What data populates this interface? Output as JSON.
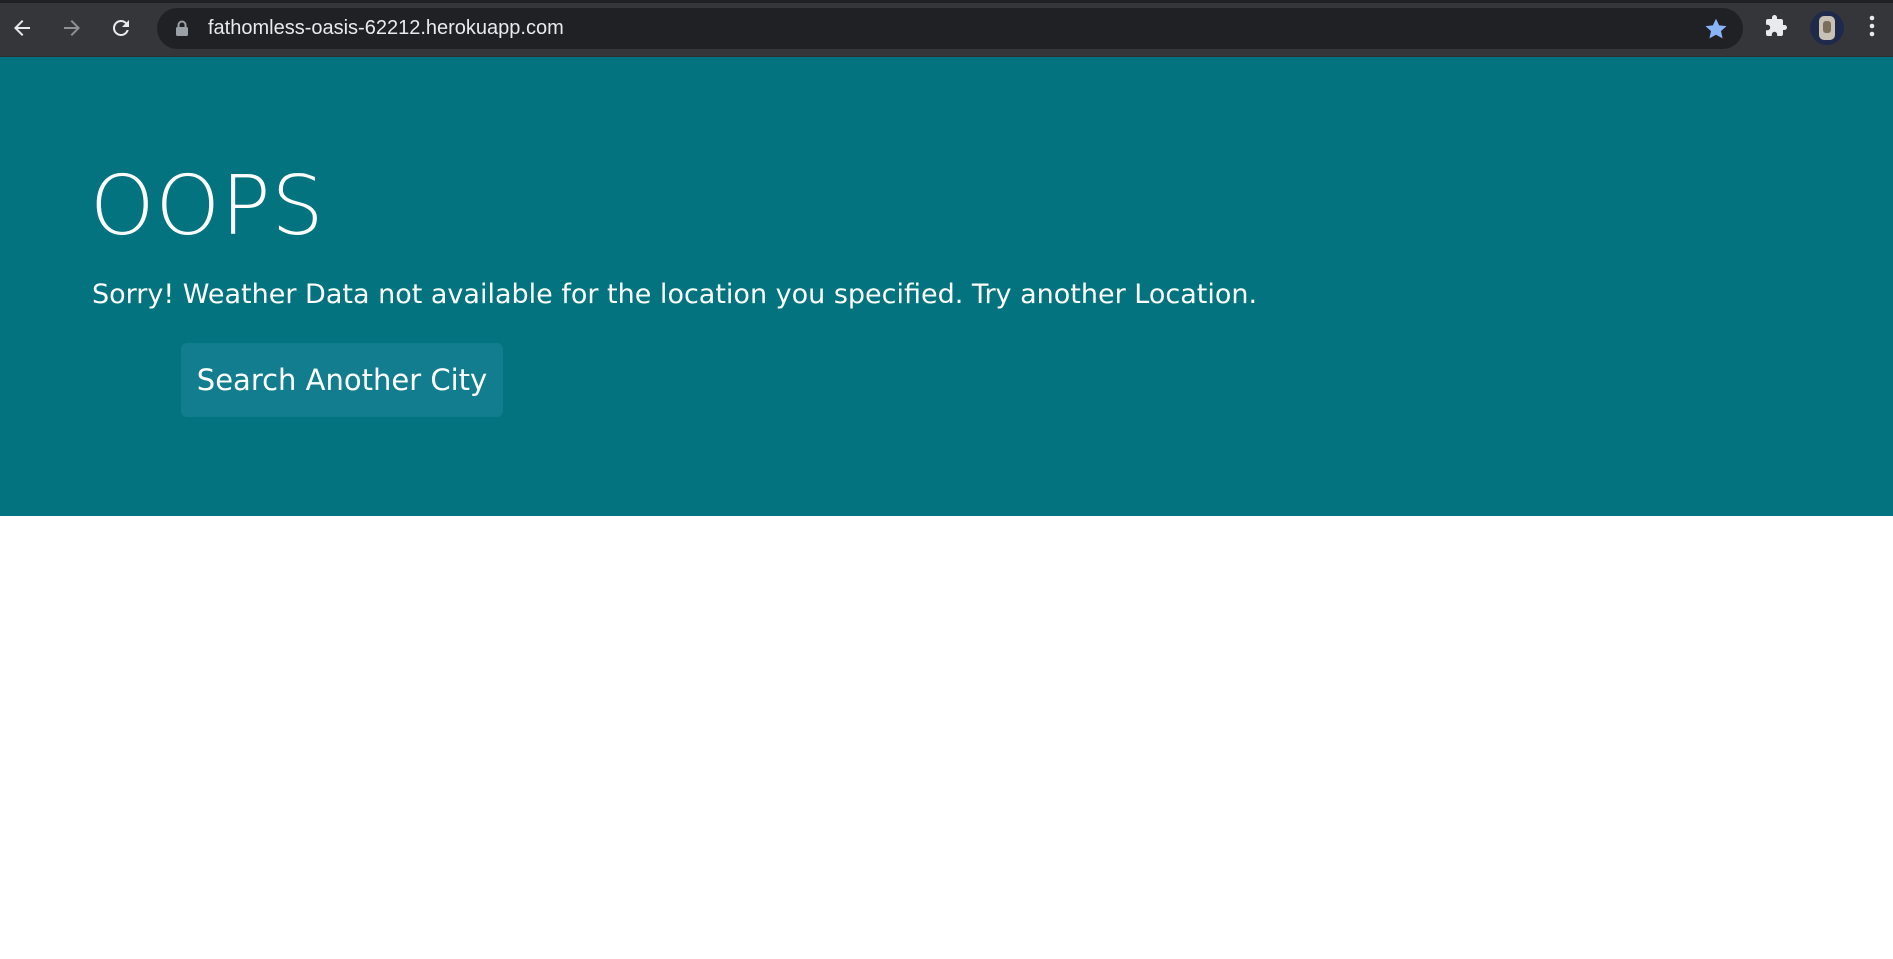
{
  "browser": {
    "url": "fathomless-oasis-62212.herokuapp.com",
    "icons": {
      "back": "back-arrow-icon",
      "forward": "forward-arrow-icon",
      "reload": "reload-icon",
      "lock": "lock-icon",
      "bookmark": "star-icon",
      "extensions": "puzzle-icon",
      "profile": "avatar",
      "menu": "kebab-menu-icon"
    },
    "colors": {
      "toolbar": "#35363a",
      "omnibox": "#202124",
      "star": "#8ab4f8"
    }
  },
  "page": {
    "heading": "OOPS",
    "message": "Sorry! Weather Data not available for the location you specified. Try another Location.",
    "button_label": "Search Another City",
    "colors": {
      "banner": "#02737f",
      "button": "#117d8e",
      "text": "#ffffff"
    }
  }
}
